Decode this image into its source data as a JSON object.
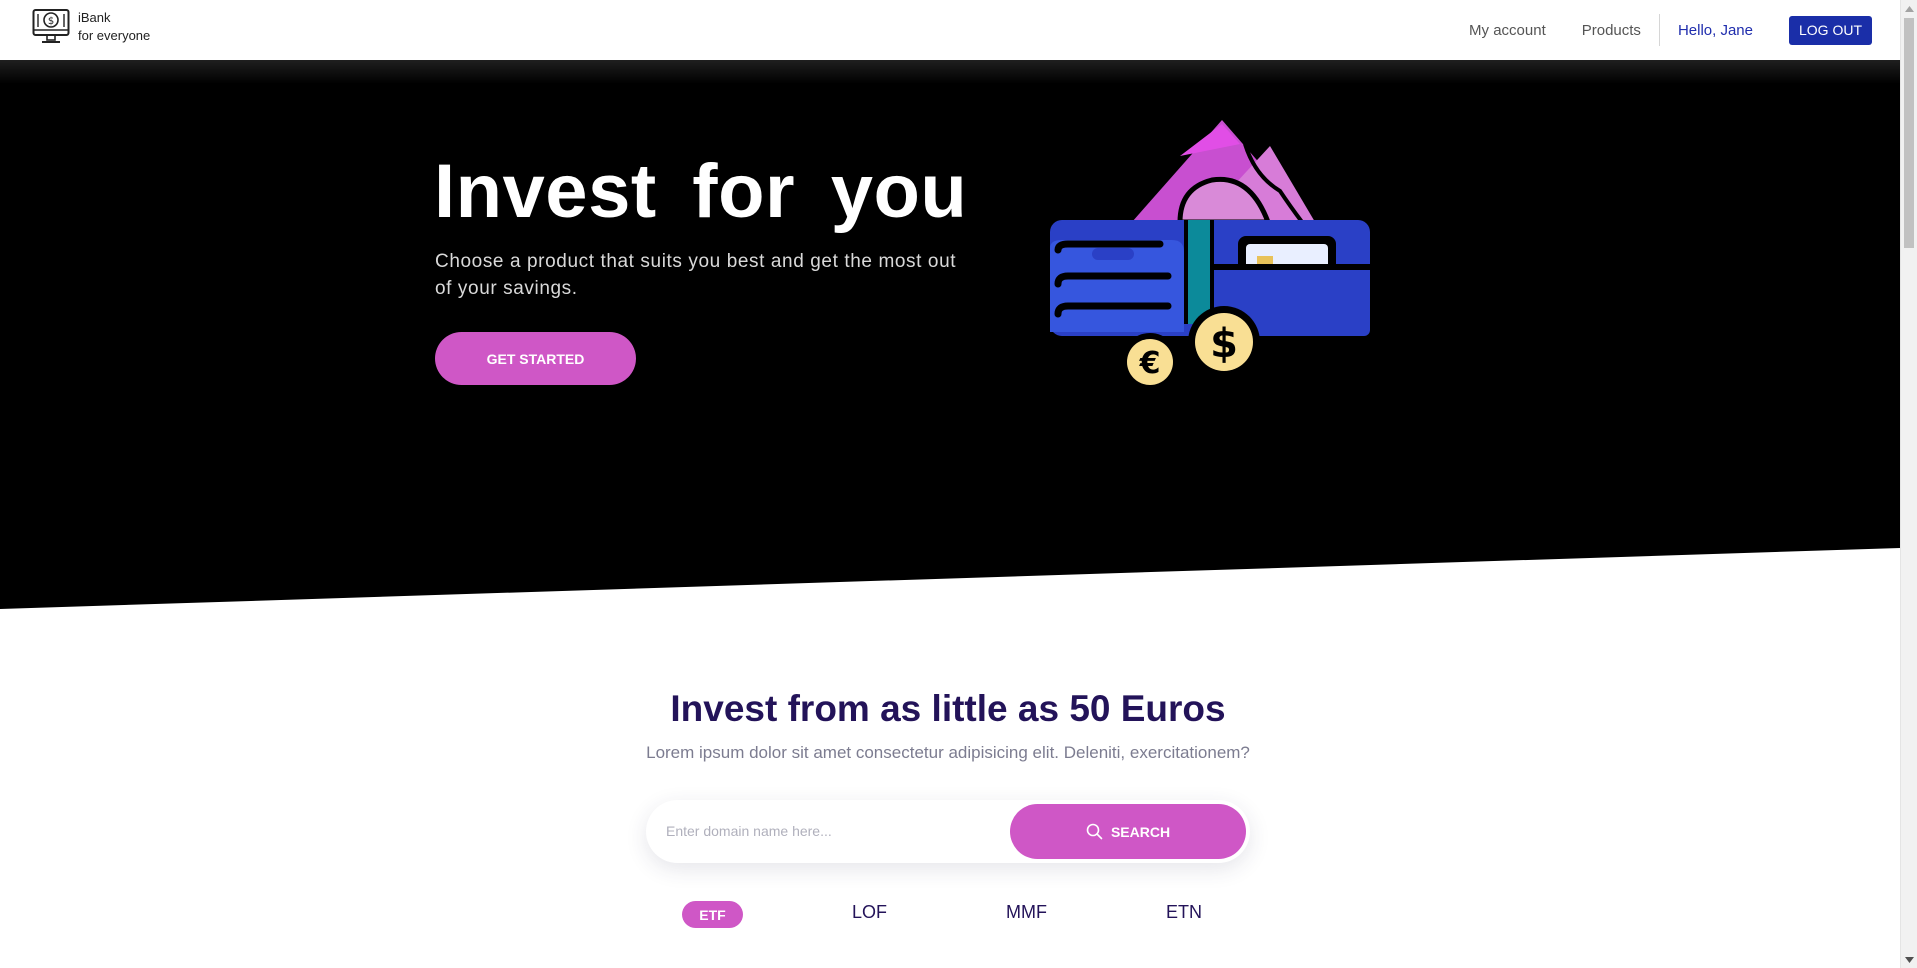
{
  "navbar": {
    "brand_line1": "iBank",
    "brand_line2": "for everyone",
    "links": [
      "My account",
      "Products"
    ],
    "user_greeting": "Hello, Jane",
    "logout_label": "LOG OUT"
  },
  "hero": {
    "title": "Invest for you",
    "subtitle": "Choose a product that suits you best and get the most out of your savings.",
    "cta_label": "GET STARTED",
    "illustration": "wallet-with-cash-and-coins",
    "currency_symbols": [
      "€",
      "$"
    ]
  },
  "section": {
    "title": "Invest from as little as 50 Euros",
    "subtitle": "Lorem ipsum dolor sit amet consectetur adipisicing elit. Deleniti, exercitationem?",
    "search": {
      "placeholder": "Enter domain name here...",
      "button_label": "SEARCH",
      "icon": "search-icon"
    },
    "tabs": [
      {
        "label": "ETF",
        "active": true
      },
      {
        "label": "LOF",
        "active": false
      },
      {
        "label": "MMF",
        "active": false
      },
      {
        "label": "ETN",
        "active": false
      }
    ]
  },
  "colors": {
    "accent": "#cf57c6",
    "primary_blue": "#1a2ea8",
    "heading_navy": "#231359",
    "hero_bg": "#000000"
  }
}
